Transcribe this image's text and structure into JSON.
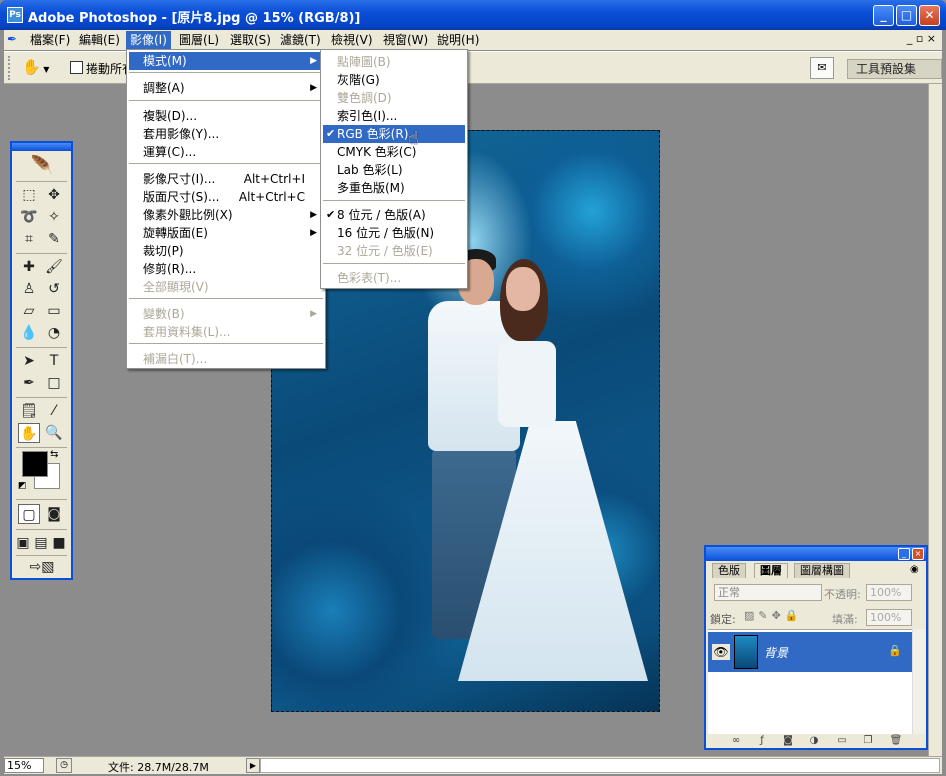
{
  "window": {
    "title": "Adobe Photoshop - [原片8.jpg @ 15% (RGB/8)]",
    "app_icon": "Ps",
    "min_btn": "_",
    "max_btn": "□",
    "close_btn": "✕"
  },
  "menubar": {
    "items": [
      "檔案(F)",
      "編輯(E)",
      "影像(I)",
      "圖層(L)",
      "選取(S)",
      "濾鏡(T)",
      "檢視(V)",
      "視窗(W)",
      "說明(H)"
    ],
    "active": "影像(I)",
    "mdi_controls": "_ ▫ ×"
  },
  "options_bar": {
    "hand_icon": "hand-icon",
    "scroll_all_label": "捲動所有",
    "preset_tab": "工具預設集"
  },
  "image_menu": {
    "items": [
      {
        "label": "模式(M)",
        "shortcut": "",
        "submenu": true,
        "highlighted": true
      },
      {
        "label": "調整(A)",
        "shortcut": "",
        "submenu": true
      },
      {
        "label": "複製(D)...",
        "shortcut": ""
      },
      {
        "label": "套用影像(Y)...",
        "shortcut": ""
      },
      {
        "label": "運算(C)...",
        "shortcut": ""
      },
      {
        "label": "影像尺寸(I)...",
        "shortcut": "Alt+Ctrl+I"
      },
      {
        "label": "版面尺寸(S)...",
        "shortcut": "Alt+Ctrl+C"
      },
      {
        "label": "像素外觀比例(X)",
        "shortcut": "",
        "submenu": true
      },
      {
        "label": "旋轉版面(E)",
        "shortcut": "",
        "submenu": true
      },
      {
        "label": "裁切(P)",
        "shortcut": ""
      },
      {
        "label": "修剪(R)...",
        "shortcut": ""
      },
      {
        "label": "全部顯現(V)",
        "shortcut": "",
        "disabled": true
      },
      {
        "label": "變數(B)",
        "shortcut": "",
        "submenu": true,
        "disabled": true
      },
      {
        "label": "套用資料集(L)...",
        "shortcut": "",
        "disabled": true
      },
      {
        "label": "補漏白(T)...",
        "shortcut": "",
        "disabled": true
      }
    ]
  },
  "mode_submenu": {
    "items": [
      {
        "label": "點陣圖(B)",
        "disabled": true
      },
      {
        "label": "灰階(G)"
      },
      {
        "label": "雙色調(D)",
        "disabled": true
      },
      {
        "label": "索引色(I)..."
      },
      {
        "label": "RGB 色彩(R)",
        "checked": true,
        "highlighted": true
      },
      {
        "label": "CMYK 色彩(C)"
      },
      {
        "label": "Lab 色彩(L)"
      },
      {
        "label": "多重色版(M)"
      },
      {
        "label": "8 位元 / 色版(A)",
        "checked": true
      },
      {
        "label": "16 位元 / 色版(N)"
      },
      {
        "label": "32 位元 / 色版(E)",
        "disabled": true
      },
      {
        "label": "色彩表(T)...",
        "disabled": true
      }
    ],
    "check_glyph": "✔",
    "arrow_glyph": "▶"
  },
  "layers_panel": {
    "tabs": [
      "色版",
      "圖層",
      "圖層構圖"
    ],
    "active_tab": "圖層",
    "blend_mode": "正常",
    "opacity_label": "不透明:",
    "opacity_value": "100%",
    "lock_label": "鎖定:",
    "fill_label": "填滿:",
    "fill_value": "100%",
    "layer_name": "背景",
    "footer_icons": [
      "link-icon",
      "fx-icon",
      "mask-icon",
      "adjustment-icon",
      "folder-icon",
      "new-layer-icon",
      "trash-icon"
    ]
  },
  "status_bar": {
    "zoom": "15%",
    "doc_size": "文件: 28.7M/28.7M"
  },
  "colors": {
    "titlebar": "#0a4fd8",
    "menu_highlight": "#316ac5",
    "workspace": "#8c8c8c",
    "chrome": "#ece9d8"
  }
}
